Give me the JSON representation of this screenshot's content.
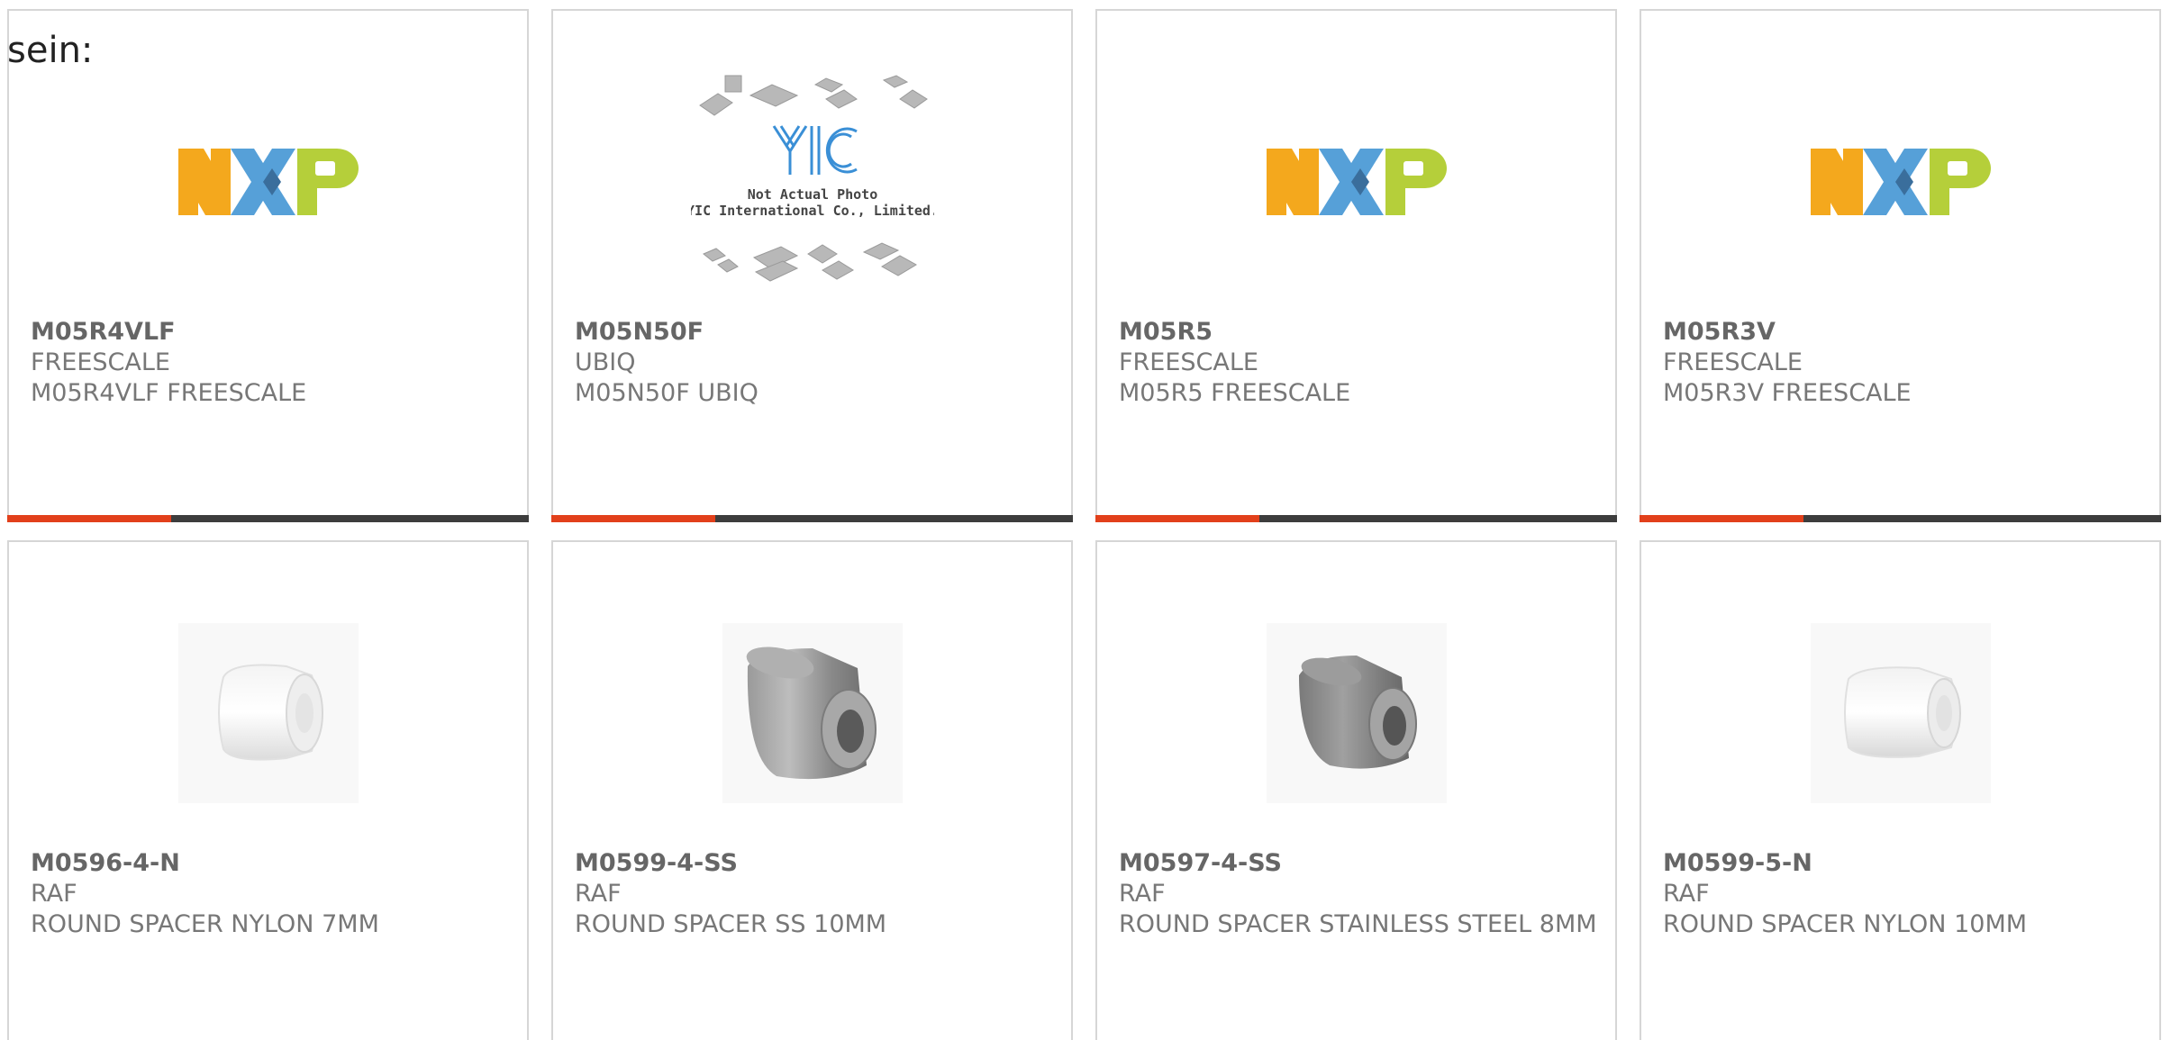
{
  "intro": {
    "text": "sein:"
  },
  "products": [
    {
      "part": "M05R4VLF",
      "maker": "FREESCALE",
      "desc": "M05R4VLF FREESCALE",
      "image": "nxp-logo-icon"
    },
    {
      "part": "M05N50F",
      "maker": "UBIQ",
      "desc": "M05N50F UBIQ",
      "image": "not-actual-photo-placeholder",
      "placeholder_line1": "Not Actual Photo",
      "placeholder_line2": "YIC International Co., Limited.",
      "placeholder_logo": "YIC"
    },
    {
      "part": "M05R5",
      "maker": "FREESCALE",
      "desc": "M05R5 FREESCALE",
      "image": "nxp-logo-icon"
    },
    {
      "part": "M05R3V",
      "maker": "FREESCALE",
      "desc": "M05R3V FREESCALE",
      "image": "nxp-logo-icon"
    },
    {
      "part": "M0596-4-N",
      "maker": "RAF",
      "desc": "ROUND SPACER NYLON 7MM",
      "image": "nylon-spacer-photo"
    },
    {
      "part": "M0599-4-SS",
      "maker": "RAF",
      "desc": "ROUND SPACER SS 10MM",
      "image": "steel-spacer-photo"
    },
    {
      "part": "M0597-4-SS",
      "maker": "RAF",
      "desc": "ROUND SPACER STAINLESS STEEL 8MM",
      "image": "steel-spacer-photo"
    },
    {
      "part": "M0599-5-N",
      "maker": "RAF",
      "desc": "ROUND SPACER NYLON 10MM",
      "image": "nylon-spacer-photo"
    }
  ],
  "colors": {
    "accent_bar": "#e2401b",
    "dark_bar": "#3d3d3d",
    "card_border": "#d6d6d6",
    "text": "#666666",
    "nxp_orange": "#f4a81d",
    "nxp_blue": "#56a0d8",
    "nxp_green": "#b5cf3a"
  }
}
